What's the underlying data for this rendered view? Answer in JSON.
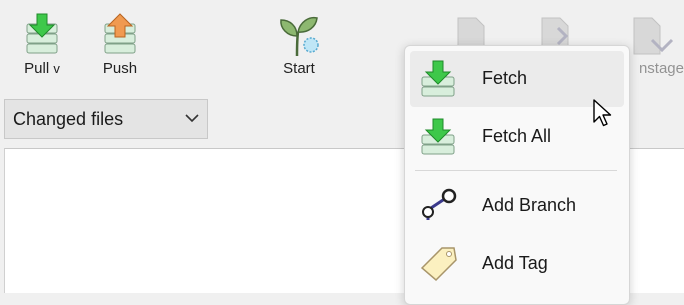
{
  "toolbar": {
    "pull_label": "Pull",
    "pull_suffix": "v",
    "push_label": "Push",
    "start_label": "Start",
    "unstage_label": "nstage"
  },
  "view_selector": {
    "selected": "Changed files",
    "icon": "chevron-down-icon"
  },
  "dropdown_menu": {
    "items": [
      {
        "label": "Fetch",
        "icon": "fetch-icon",
        "highlighted": true
      },
      {
        "label": "Fetch All",
        "icon": "fetch-all-icon",
        "highlighted": false
      },
      {
        "label": "Add Branch",
        "icon": "branch-icon",
        "highlighted": false
      },
      {
        "label": "Add Tag",
        "icon": "tag-icon",
        "highlighted": false
      }
    ]
  },
  "colors": {
    "download_arrow": "#3ec84a",
    "upload_arrow": "#f09a50",
    "stack": "#d8eedc",
    "highlight": "#ebebeb",
    "branch_line": "#3b3a8c",
    "tag_fill": "#fbf0c0"
  }
}
